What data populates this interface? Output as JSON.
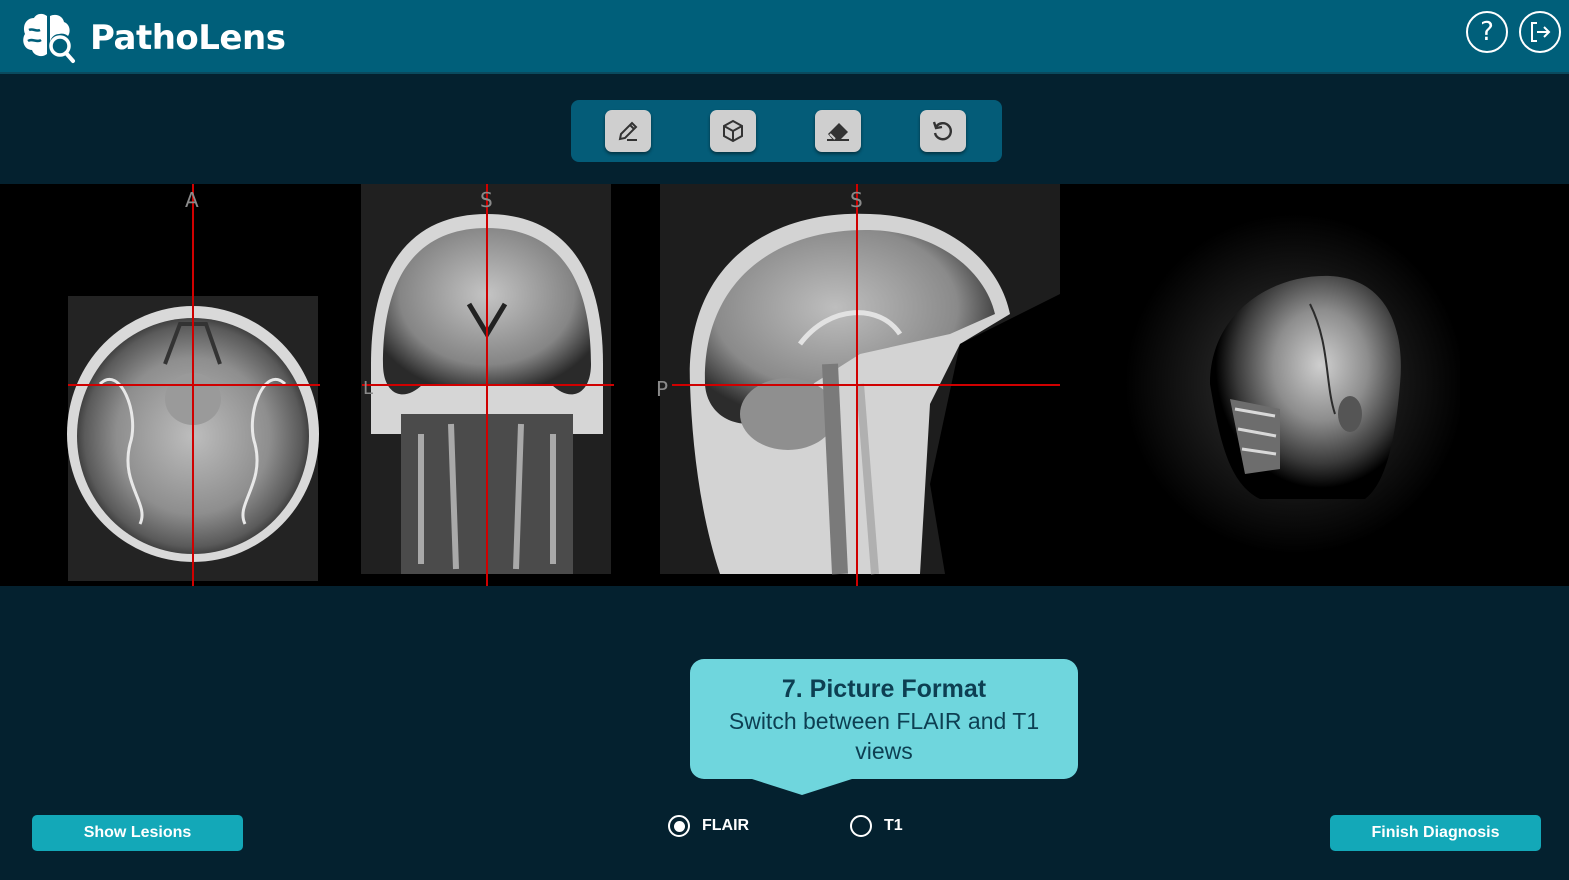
{
  "app": {
    "title": "PathoLens",
    "colors": {
      "header": "#005f7a",
      "background": "#04212f",
      "accent": "#13a8b8",
      "tooltip": "#6fd6dd"
    }
  },
  "header": {
    "logo_icon": "brain-magnifier-icon",
    "help_icon": "question-mark-icon",
    "logout_icon": "logout-icon"
  },
  "toolbar": {
    "tools": [
      {
        "icon": "pencil-icon"
      },
      {
        "icon": "cube-icon"
      },
      {
        "icon": "eraser-icon"
      },
      {
        "icon": "undo-icon"
      }
    ]
  },
  "viewer": {
    "axial": {
      "orientation_top": "A"
    },
    "coronal": {
      "orientation_top": "S",
      "orientation_left": "L"
    },
    "sagittal": {
      "orientation_top": "S",
      "orientation_left": "P"
    },
    "render3d": {
      "label": ""
    }
  },
  "tooltip": {
    "title": "7. Picture Format",
    "body": "Switch between FLAIR and T1 views"
  },
  "format": {
    "options": [
      "FLAIR",
      "T1"
    ],
    "selected": "FLAIR"
  },
  "actions": {
    "show_lesions": "Show Lesions",
    "finish_diagnosis": "Finish Diagnosis"
  }
}
